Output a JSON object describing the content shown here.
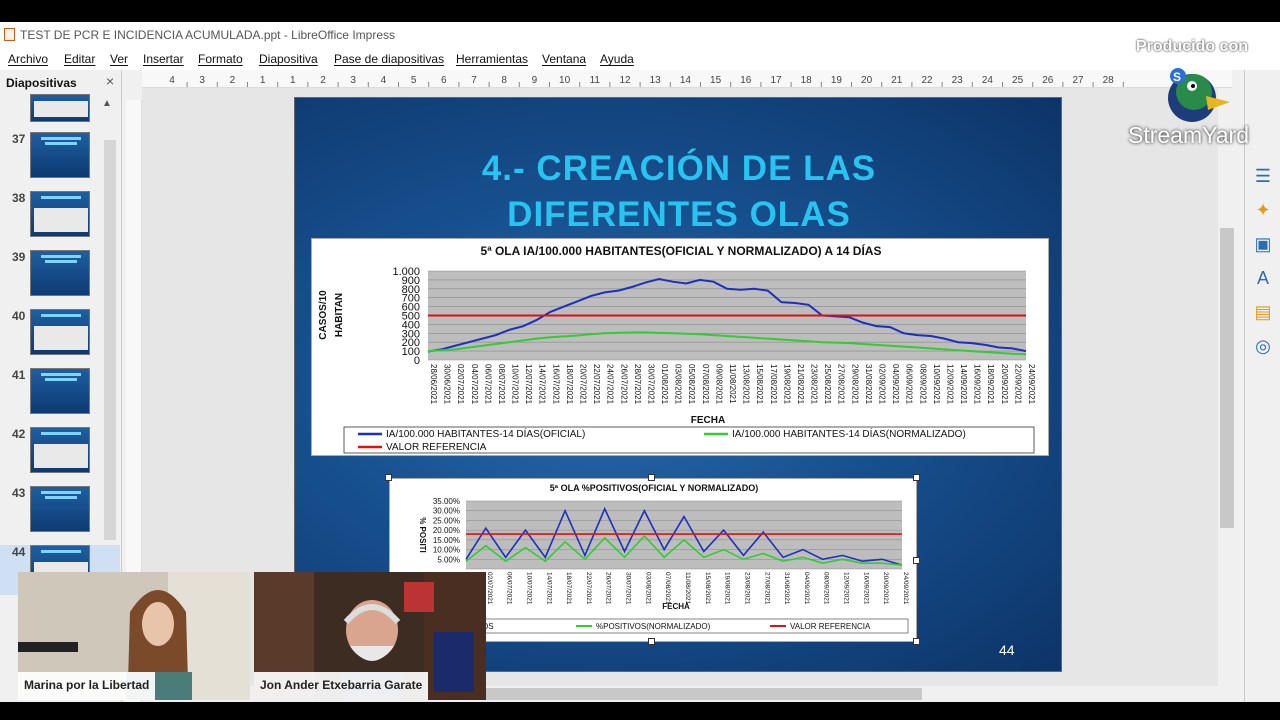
{
  "window": {
    "title": "TEST DE PCR E INCIDENCIA ACUMULADA.ppt - LibreOffice Impress"
  },
  "menu": [
    "Archivo",
    "Editar",
    "Ver",
    "Insertar",
    "Formato",
    "Diapositiva",
    "Pase de diapositivas",
    "Herramientas",
    "Ventana",
    "Ayuda"
  ],
  "sidebar": {
    "title": "Diapositivas",
    "close_glyph": "×",
    "slides": [
      {
        "num": "37",
        "kind": "title"
      },
      {
        "num": "38",
        "kind": "chart"
      },
      {
        "num": "39",
        "kind": "title"
      },
      {
        "num": "40",
        "kind": "chart"
      },
      {
        "num": "41",
        "kind": "title"
      },
      {
        "num": "42",
        "kind": "chart"
      },
      {
        "num": "43",
        "kind": "title"
      },
      {
        "num": "44",
        "kind": "chart",
        "selected": true
      }
    ]
  },
  "ruler": {
    "top_ticks": [
      "4",
      "3",
      "2",
      "1",
      "1",
      "2",
      "3",
      "4",
      "5",
      "6",
      "7",
      "8",
      "9",
      "10",
      "11",
      "12",
      "13",
      "14",
      "15",
      "16",
      "17",
      "18",
      "19",
      "20",
      "21",
      "22",
      "23",
      "24",
      "25",
      "26",
      "27",
      "28"
    ]
  },
  "slide": {
    "title_line1": "4.- CREACIÓN DE LAS",
    "title_line2": "DIFERENTES OLAS",
    "number": "44"
  },
  "chart_data": [
    {
      "type": "line",
      "title": "5ª OLA IA/100.000 HABITANTES(OFICIAL Y NORMALIZADO) A 14 DÍAS",
      "ylabel_line1": "CASOS/10",
      "ylabel_line2": "HABITAN",
      "xlabel": "FECHA",
      "ylim": [
        0,
        1000
      ],
      "yticks": [
        "1.000",
        "900",
        "800",
        "700",
        "600",
        "500",
        "400",
        "300",
        "200",
        "100",
        "0"
      ],
      "categories": [
        "28/06/2021",
        "30/06/2021",
        "02/07/2021",
        "04/07/2021",
        "06/07/2021",
        "08/07/2021",
        "10/07/2021",
        "12/07/2021",
        "14/07/2021",
        "16/07/2021",
        "18/07/2021",
        "20/07/2021",
        "22/07/2021",
        "24/07/2021",
        "26/07/2021",
        "28/07/2021",
        "30/07/2021",
        "01/08/2021",
        "03/08/2021",
        "05/08/2021",
        "07/08/2021",
        "09/08/2021",
        "11/08/2021",
        "13/08/2021",
        "15/08/2021",
        "17/08/2021",
        "19/08/2021",
        "21/08/2021",
        "23/08/2021",
        "25/08/2021",
        "27/08/2021",
        "29/08/2021",
        "31/08/2021",
        "02/09/2021",
        "04/09/2021",
        "06/09/2021",
        "08/09/2021",
        "10/09/2021",
        "12/09/2021",
        "14/09/2021",
        "16/09/2021",
        "18/09/2021",
        "20/09/2021",
        "22/09/2021",
        "24/09/2021"
      ],
      "series": [
        {
          "name": "IA/100.000 HABITANTES-14 DÍAS(OFICIAL)",
          "color": "#1d2fbf",
          "values": [
            95,
            120,
            160,
            200,
            240,
            280,
            340,
            380,
            450,
            540,
            600,
            660,
            720,
            760,
            780,
            820,
            870,
            910,
            880,
            860,
            900,
            880,
            800,
            790,
            800,
            780,
            650,
            640,
            620,
            500,
            490,
            480,
            420,
            380,
            370,
            300,
            280,
            270,
            240,
            200,
            190,
            170,
            140,
            130,
            100
          ]
        },
        {
          "name": "IA/100.000 HABITANTES-14 DÍAS(NORMALIZADO)",
          "color": "#33cc33",
          "values": [
            100,
            110,
            120,
            140,
            160,
            180,
            200,
            220,
            240,
            255,
            265,
            275,
            290,
            300,
            305,
            310,
            310,
            305,
            300,
            295,
            290,
            280,
            270,
            260,
            250,
            240,
            230,
            220,
            210,
            200,
            195,
            190,
            180,
            170,
            160,
            150,
            140,
            130,
            120,
            110,
            100,
            90,
            80,
            70,
            65
          ]
        },
        {
          "name": "VALOR REFERENCIA",
          "color": "#e01010",
          "values": [
            500,
            500,
            500,
            500,
            500,
            500,
            500,
            500,
            500,
            500,
            500,
            500,
            500,
            500,
            500,
            500,
            500,
            500,
            500,
            500,
            500,
            500,
            500,
            500,
            500,
            500,
            500,
            500,
            500,
            500,
            500,
            500,
            500,
            500,
            500,
            500,
            500,
            500,
            500,
            500,
            500,
            500,
            500,
            500,
            500
          ]
        }
      ]
    },
    {
      "type": "line",
      "title": "5ª OLA %POSITIVOS(OFICIAL Y NORMALIZADO)",
      "ylabel": "% POSITI",
      "ylim": [
        0,
        0.35
      ],
      "yticks": [
        "35.00%",
        "30.00%",
        "25.00%",
        "20.00%",
        "15.00%",
        "10.00%",
        "5.00%"
      ],
      "xlabel_partial": "FECHA",
      "categories": [
        "28/06/2021",
        "02/07/2021",
        "06/07/2021",
        "10/07/2021",
        "14/07/2021",
        "18/07/2021",
        "22/07/2021",
        "26/07/2021",
        "30/07/2021",
        "03/08/2021",
        "07/08/2021",
        "11/08/2021",
        "15/08/2021",
        "19/08/2021",
        "23/08/2021",
        "27/08/2021",
        "31/08/2021",
        "04/09/2021",
        "08/09/2021",
        "12/09/2021",
        "16/09/2021",
        "20/09/2021",
        "24/09/2021"
      ],
      "series": [
        {
          "name_visible": "SITIVOS",
          "color": "#1d2fbf",
          "values": [
            0.05,
            0.21,
            0.06,
            0.2,
            0.06,
            0.3,
            0.07,
            0.31,
            0.09,
            0.3,
            0.1,
            0.27,
            0.09,
            0.2,
            0.07,
            0.19,
            0.06,
            0.1,
            0.05,
            0.07,
            0.04,
            0.05,
            0.02
          ]
        },
        {
          "name": "%POSITIVOS(NORMALIZADO)",
          "color": "#33cc33",
          "values": [
            0.04,
            0.12,
            0.04,
            0.11,
            0.04,
            0.14,
            0.05,
            0.16,
            0.06,
            0.17,
            0.06,
            0.15,
            0.06,
            0.1,
            0.05,
            0.08,
            0.04,
            0.06,
            0.03,
            0.05,
            0.03,
            0.03,
            0.02
          ]
        },
        {
          "name": "VALOR REFERENCIA",
          "color": "#e01010",
          "values": [
            0.18,
            0.18,
            0.18,
            0.18,
            0.18,
            0.18,
            0.18,
            0.18,
            0.18,
            0.18,
            0.18,
            0.18,
            0.18,
            0.18,
            0.18,
            0.18,
            0.18,
            0.18,
            0.18,
            0.18,
            0.18,
            0.18,
            0.18
          ]
        }
      ]
    }
  ],
  "overlay": {
    "produced_by": "Producido con",
    "brand": "StreamYard"
  },
  "participants": [
    {
      "name": "Marina por la Libertad"
    },
    {
      "name": "Jon Ander Etxebarria Garate"
    }
  ]
}
